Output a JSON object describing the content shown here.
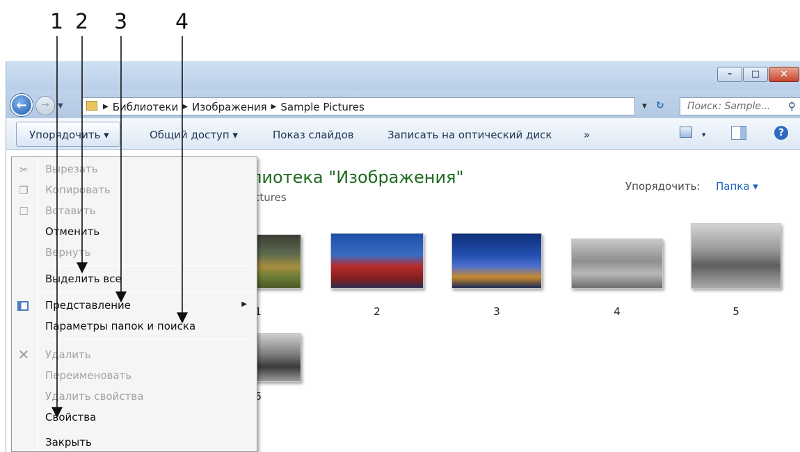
{
  "callouts": [
    "1",
    "2",
    "3",
    "4"
  ],
  "window": {
    "minimize": "–",
    "maximize": "□",
    "close": "✕"
  },
  "address": {
    "back_icon": "back-arrow-icon",
    "forward_icon": "forward-arrow-icon",
    "crumbs": [
      "Библиотеки",
      "Изображения",
      "Sample Pictures"
    ],
    "search_placeholder": "Поиск: Sample..."
  },
  "toolbar": {
    "organize": "Упорядочить ▾",
    "share": "Общий доступ ▾",
    "slideshow": "Показ слайдов",
    "burn": "Записать на оптический диск",
    "more": "»",
    "views": "▾"
  },
  "library": {
    "title": "лиотека \"Изображения\"",
    "subtitle": "ictures",
    "arrange_label": "Упорядочить:",
    "arrange_value": "Папка ▾"
  },
  "thumbnails": [
    "1",
    "2",
    "3",
    "4",
    "5",
    "6"
  ],
  "menu": {
    "items": [
      {
        "label": "Вырезать",
        "enabled": false,
        "icon": "scissors-icon"
      },
      {
        "label": "Копировать",
        "enabled": false,
        "icon": "copy-icon"
      },
      {
        "label": "Вставить",
        "enabled": false,
        "icon": "paste-icon"
      },
      {
        "label": "Отменить",
        "enabled": true
      },
      {
        "label": "Вернуть",
        "enabled": false
      },
      {
        "label": "Выделить все",
        "enabled": true
      },
      {
        "label": "Представление",
        "enabled": true,
        "icon": "layout-icon",
        "submenu": true
      },
      {
        "label": "Параметры папок и поиска",
        "enabled": true
      },
      {
        "label": "Удалить",
        "enabled": false,
        "icon": "delete-x-icon"
      },
      {
        "label": "Переименовать",
        "enabled": false
      },
      {
        "label": "Удалить свойства",
        "enabled": false
      },
      {
        "label": "Свойства",
        "enabled": true
      },
      {
        "label": "Закрыть",
        "enabled": true
      }
    ]
  }
}
